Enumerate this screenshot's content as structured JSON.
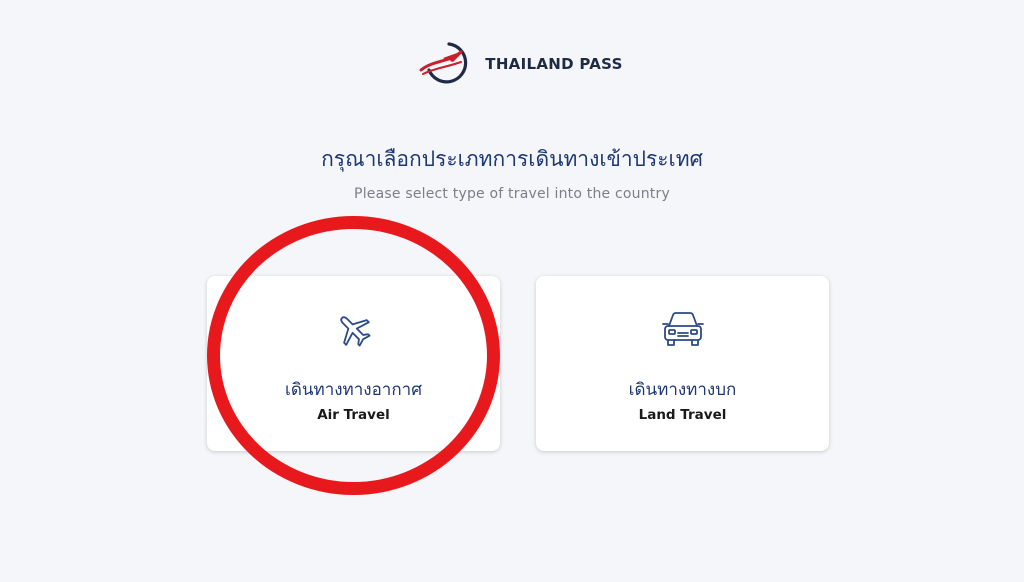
{
  "header": {
    "brand_name": "THAILAND PASS",
    "logo_icon": "thailand-pass-logo",
    "colors": {
      "navy": "#1f2a44",
      "red": "#c8202c"
    }
  },
  "main": {
    "title_thai": "กรุณาเลือกประเภทการเดินทางเข้าประเทศ",
    "subtitle": "Please select type of travel into the country"
  },
  "options": [
    {
      "icon": "airplane-icon",
      "label_thai": "เดินทางทางอากาศ",
      "label_en": "Air Travel"
    },
    {
      "icon": "car-icon",
      "label_thai": "เดินทางทางบก",
      "label_en": "Land Travel"
    }
  ],
  "annotation": {
    "highlight_color": "#e8191d"
  },
  "colors": {
    "background": "#f4f6f9",
    "title_blue": "#1e3775",
    "subtitle_gray": "#7a7f88",
    "icon_blue": "#2c4a87"
  }
}
